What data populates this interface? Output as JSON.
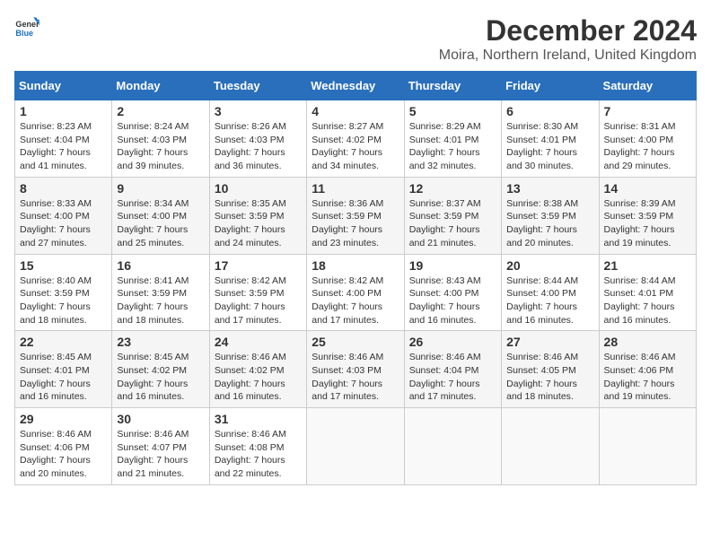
{
  "logo": {
    "general": "General",
    "blue": "Blue"
  },
  "title": "December 2024",
  "subtitle": "Moira, Northern Ireland, United Kingdom",
  "days_of_week": [
    "Sunday",
    "Monday",
    "Tuesday",
    "Wednesday",
    "Thursday",
    "Friday",
    "Saturday"
  ],
  "weeks": [
    [
      {
        "day": "1",
        "sunrise": "8:23 AM",
        "sunset": "4:04 PM",
        "daylight": "7 hours and 41 minutes."
      },
      {
        "day": "2",
        "sunrise": "8:24 AM",
        "sunset": "4:03 PM",
        "daylight": "7 hours and 39 minutes."
      },
      {
        "day": "3",
        "sunrise": "8:26 AM",
        "sunset": "4:03 PM",
        "daylight": "7 hours and 36 minutes."
      },
      {
        "day": "4",
        "sunrise": "8:27 AM",
        "sunset": "4:02 PM",
        "daylight": "7 hours and 34 minutes."
      },
      {
        "day": "5",
        "sunrise": "8:29 AM",
        "sunset": "4:01 PM",
        "daylight": "7 hours and 32 minutes."
      },
      {
        "day": "6",
        "sunrise": "8:30 AM",
        "sunset": "4:01 PM",
        "daylight": "7 hours and 30 minutes."
      },
      {
        "day": "7",
        "sunrise": "8:31 AM",
        "sunset": "4:00 PM",
        "daylight": "7 hours and 29 minutes."
      }
    ],
    [
      {
        "day": "8",
        "sunrise": "8:33 AM",
        "sunset": "4:00 PM",
        "daylight": "7 hours and 27 minutes."
      },
      {
        "day": "9",
        "sunrise": "8:34 AM",
        "sunset": "4:00 PM",
        "daylight": "7 hours and 25 minutes."
      },
      {
        "day": "10",
        "sunrise": "8:35 AM",
        "sunset": "3:59 PM",
        "daylight": "7 hours and 24 minutes."
      },
      {
        "day": "11",
        "sunrise": "8:36 AM",
        "sunset": "3:59 PM",
        "daylight": "7 hours and 23 minutes."
      },
      {
        "day": "12",
        "sunrise": "8:37 AM",
        "sunset": "3:59 PM",
        "daylight": "7 hours and 21 minutes."
      },
      {
        "day": "13",
        "sunrise": "8:38 AM",
        "sunset": "3:59 PM",
        "daylight": "7 hours and 20 minutes."
      },
      {
        "day": "14",
        "sunrise": "8:39 AM",
        "sunset": "3:59 PM",
        "daylight": "7 hours and 19 minutes."
      }
    ],
    [
      {
        "day": "15",
        "sunrise": "8:40 AM",
        "sunset": "3:59 PM",
        "daylight": "7 hours and 18 minutes."
      },
      {
        "day": "16",
        "sunrise": "8:41 AM",
        "sunset": "3:59 PM",
        "daylight": "7 hours and 18 minutes."
      },
      {
        "day": "17",
        "sunrise": "8:42 AM",
        "sunset": "3:59 PM",
        "daylight": "7 hours and 17 minutes."
      },
      {
        "day": "18",
        "sunrise": "8:42 AM",
        "sunset": "4:00 PM",
        "daylight": "7 hours and 17 minutes."
      },
      {
        "day": "19",
        "sunrise": "8:43 AM",
        "sunset": "4:00 PM",
        "daylight": "7 hours and 16 minutes."
      },
      {
        "day": "20",
        "sunrise": "8:44 AM",
        "sunset": "4:00 PM",
        "daylight": "7 hours and 16 minutes."
      },
      {
        "day": "21",
        "sunrise": "8:44 AM",
        "sunset": "4:01 PM",
        "daylight": "7 hours and 16 minutes."
      }
    ],
    [
      {
        "day": "22",
        "sunrise": "8:45 AM",
        "sunset": "4:01 PM",
        "daylight": "7 hours and 16 minutes."
      },
      {
        "day": "23",
        "sunrise": "8:45 AM",
        "sunset": "4:02 PM",
        "daylight": "7 hours and 16 minutes."
      },
      {
        "day": "24",
        "sunrise": "8:46 AM",
        "sunset": "4:02 PM",
        "daylight": "7 hours and 16 minutes."
      },
      {
        "day": "25",
        "sunrise": "8:46 AM",
        "sunset": "4:03 PM",
        "daylight": "7 hours and 17 minutes."
      },
      {
        "day": "26",
        "sunrise": "8:46 AM",
        "sunset": "4:04 PM",
        "daylight": "7 hours and 17 minutes."
      },
      {
        "day": "27",
        "sunrise": "8:46 AM",
        "sunset": "4:05 PM",
        "daylight": "7 hours and 18 minutes."
      },
      {
        "day": "28",
        "sunrise": "8:46 AM",
        "sunset": "4:06 PM",
        "daylight": "7 hours and 19 minutes."
      }
    ],
    [
      {
        "day": "29",
        "sunrise": "8:46 AM",
        "sunset": "4:06 PM",
        "daylight": "7 hours and 20 minutes."
      },
      {
        "day": "30",
        "sunrise": "8:46 AM",
        "sunset": "4:07 PM",
        "daylight": "7 hours and 21 minutes."
      },
      {
        "day": "31",
        "sunrise": "8:46 AM",
        "sunset": "4:08 PM",
        "daylight": "7 hours and 22 minutes."
      },
      null,
      null,
      null,
      null
    ]
  ],
  "labels": {
    "sunrise": "Sunrise:",
    "sunset": "Sunset:",
    "daylight": "Daylight:"
  }
}
